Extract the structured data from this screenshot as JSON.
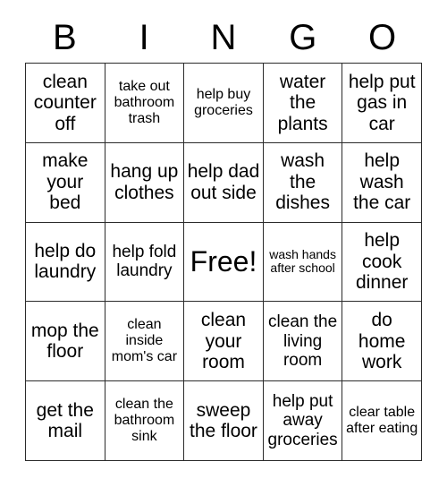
{
  "card": {
    "title": "BINGO",
    "header_letters": [
      "B",
      "I",
      "N",
      "G",
      "O"
    ],
    "free_space_label": "Free!",
    "colors": {
      "background": "#ffffff",
      "border": "#2b2b2b",
      "text": "#000000"
    },
    "grid": {
      "rows": 5,
      "columns": 5
    }
  },
  "cells": [
    {
      "text": "clean counter off",
      "size": "fs-lg"
    },
    {
      "text": "take out bathroom trash",
      "size": "fs-sm"
    },
    {
      "text": "help buy groceries",
      "size": "fs-sm"
    },
    {
      "text": "water the plants",
      "size": "fs-lg"
    },
    {
      "text": "help put gas in car",
      "size": "fs-lg"
    },
    {
      "text": "make your bed",
      "size": "fs-lg"
    },
    {
      "text": "hang up clothes",
      "size": "fs-lg"
    },
    {
      "text": "help dad out side",
      "size": "fs-lg"
    },
    {
      "text": "wash the dishes",
      "size": "fs-lg"
    },
    {
      "text": "help wash the car",
      "size": "fs-lg"
    },
    {
      "text": "help do laundry",
      "size": "fs-lg"
    },
    {
      "text": "help fold laundry",
      "size": "fs-md"
    },
    {
      "text": "Free!",
      "size": "fs-xl"
    },
    {
      "text": "wash hands after school",
      "size": "fs-xs"
    },
    {
      "text": "help cook dinner",
      "size": "fs-lg"
    },
    {
      "text": "mop the floor",
      "size": "fs-lg"
    },
    {
      "text": "clean inside mom's car",
      "size": "fs-sm"
    },
    {
      "text": "clean your room",
      "size": "fs-lg"
    },
    {
      "text": "clean the living room",
      "size": "fs-md"
    },
    {
      "text": "do home work",
      "size": "fs-lg"
    },
    {
      "text": "get the mail",
      "size": "fs-lg"
    },
    {
      "text": "clean the bathroom sink",
      "size": "fs-sm"
    },
    {
      "text": "sweep the floor",
      "size": "fs-lg"
    },
    {
      "text": "help put away groceries",
      "size": "fs-md"
    },
    {
      "text": "clear table after eating",
      "size": "fs-sm"
    }
  ]
}
